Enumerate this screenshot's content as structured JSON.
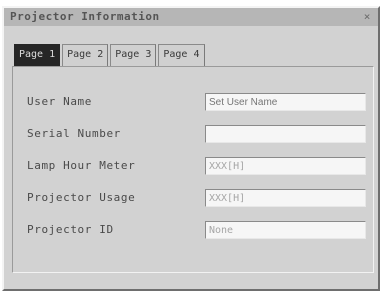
{
  "window": {
    "title": "Projector Information",
    "close_label": "×"
  },
  "tabs": [
    {
      "label": "Page 1"
    },
    {
      "label": "Page 2"
    },
    {
      "label": "Page 3"
    },
    {
      "label": "Page 4"
    }
  ],
  "fields": [
    {
      "label": "User Name",
      "value": "",
      "placeholder": "Set User Name"
    },
    {
      "label": "Serial Number",
      "value": "",
      "placeholder": ""
    },
    {
      "label": "Lamp Hour Meter",
      "value": "XXX[H]",
      "placeholder": ""
    },
    {
      "label": "Projector Usage",
      "value": "XXX[H]",
      "placeholder": ""
    },
    {
      "label": "Projector ID",
      "value": "None",
      "placeholder": ""
    }
  ]
}
